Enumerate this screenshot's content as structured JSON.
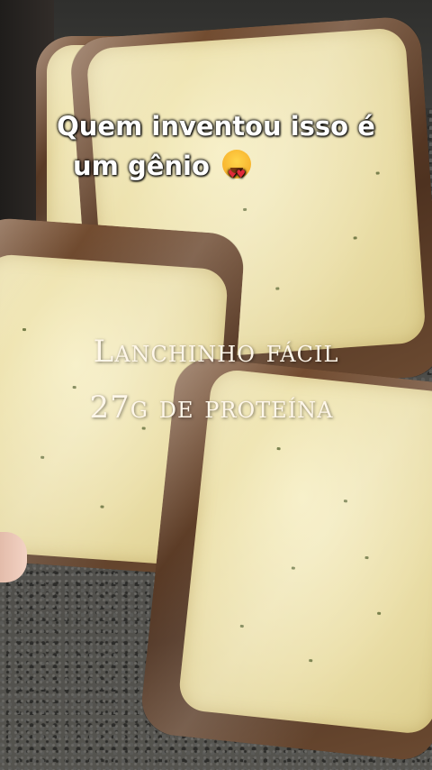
{
  "caption": {
    "line1": "Quem inventou isso é",
    "line2": "um gênio",
    "emoji": "heart-eyes-emoji"
  },
  "overlay": {
    "line1": "Lanchinho fácil",
    "line2": "27g de proteína"
  }
}
